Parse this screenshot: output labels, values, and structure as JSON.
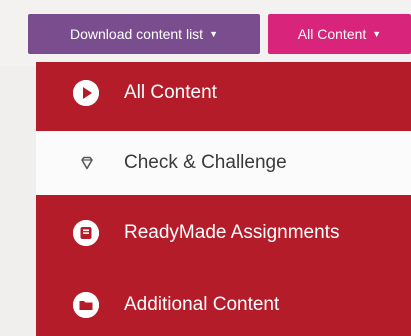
{
  "toolbar": {
    "download_label": "Download content list",
    "filter_label": "All Content"
  },
  "menu": {
    "items": [
      {
        "label": "All Content",
        "icon": "play-icon"
      },
      {
        "label": "Check & Challenge",
        "icon": "diamond-icon"
      },
      {
        "label": "ReadyMade Assignments",
        "icon": "assignment-icon"
      },
      {
        "label": "Additional Content",
        "icon": "folder-icon"
      }
    ]
  },
  "colors": {
    "download_button": "#7a4e8e",
    "filter_button": "#d8247a",
    "menu_background": "#b41c2a",
    "menu_selected": "#fbfbfb",
    "icon_accent": "#b41c2a"
  }
}
